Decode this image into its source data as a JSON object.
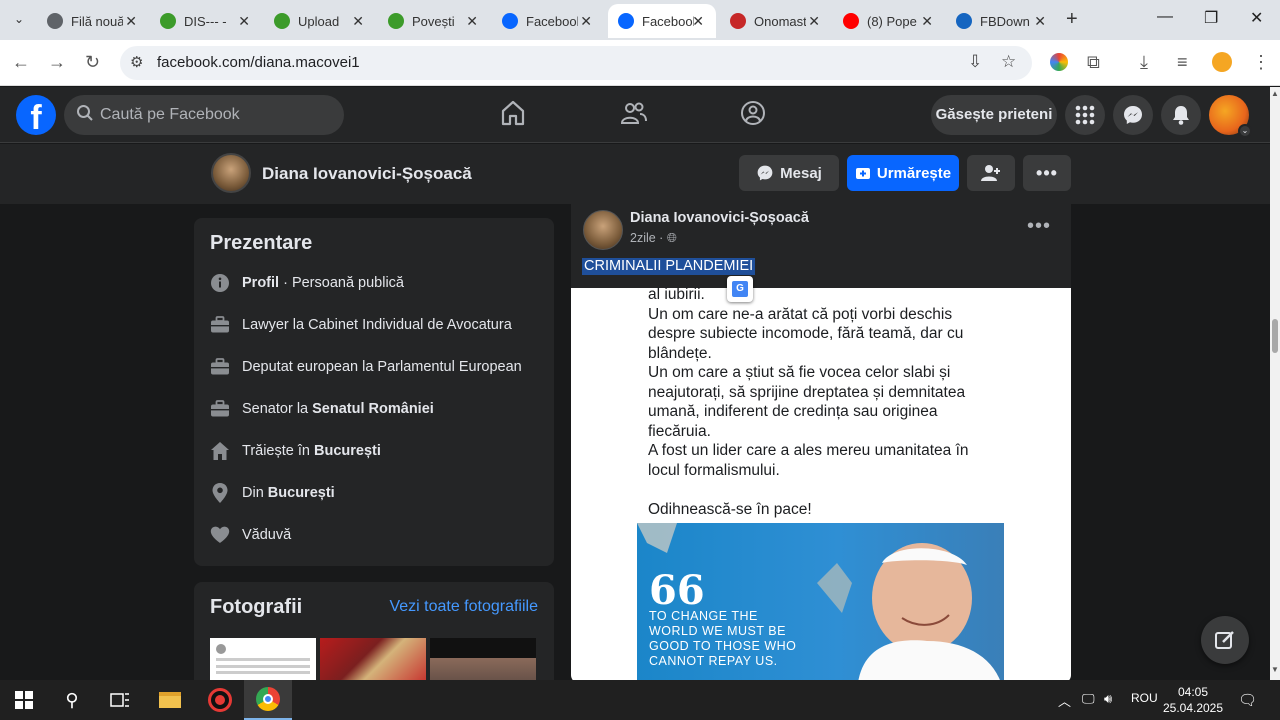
{
  "browser": {
    "tabs": [
      {
        "title": "Filă nouă",
        "favicon_color": "#5f6368",
        "active": false
      },
      {
        "title": "DIS--- -",
        "favicon_color": "#3c9b2a",
        "active": false
      },
      {
        "title": "Upload",
        "favicon_color": "#3c9b2a",
        "active": false
      },
      {
        "title": "Povești",
        "favicon_color": "#3c9b2a",
        "active": false
      },
      {
        "title": "Facebook",
        "favicon_color": "#0866ff",
        "active": false
      },
      {
        "title": "Facebook",
        "favicon_color": "#0866ff",
        "active": true
      },
      {
        "title": "Onomastica",
        "favicon_color": "#c62828",
        "active": false
      },
      {
        "title": "(8) Pope",
        "favicon_color": "#ff0000",
        "active": false
      },
      {
        "title": "FBDown",
        "favicon_color": "#1565c0",
        "active": false
      }
    ],
    "url": "facebook.com/diana.macovei1"
  },
  "facebook": {
    "search_placeholder": "Caută pe Facebook",
    "find_friends": "Găsește prieteni"
  },
  "profile": {
    "name": "Diana Iovanovici-Șoșoacă",
    "message_btn": "Mesaj",
    "follow_btn": "Urmărește"
  },
  "intro": {
    "title": "Prezentare",
    "rows": [
      {
        "icon": "info-icon",
        "text_bold": "Profil",
        "text": " · Persoană publică"
      },
      {
        "icon": "briefcase-icon",
        "text": "Lawyer la Cabinet Individual de Avocatura"
      },
      {
        "icon": "briefcase-icon",
        "text": "Deputat european la Parlamentul European"
      },
      {
        "icon": "briefcase-icon",
        "text": "Senator la ",
        "text_bold": "Senatul României"
      },
      {
        "icon": "home-icon",
        "text": "Trăiește în ",
        "text_bold": "București"
      },
      {
        "icon": "location-pin-icon",
        "text": "Din ",
        "text_bold": "București"
      },
      {
        "icon": "heart-icon",
        "text": "Văduvă"
      }
    ]
  },
  "photos": {
    "title": "Fotografii",
    "see_all": "Vezi toate fotografiile"
  },
  "post": {
    "author": "Diana Iovanovici-Șoșoacă",
    "time": "2zile ·",
    "selected_text": "CRIMINALII PLANDEMIEI",
    "body": "al iubirii.\nUn om care ne-a arătat că poți vorbi deschis despre subiecte incomode, fără teamă, dar cu blândețe.\nUn om care a știut să fie vocea celor slabi și neajutorați, să sprijine dreptatea și demnitatea umană, indiferent de credința sau originea fiecăruia.\nA fost un lider care a ales mereu umanitatea în locul formalismului.\n\nOdihnească-se în pace!",
    "image_quote_mark": "66",
    "image_quote": "TO CHANGE THE WORLD WE MUST BE GOOD TO THOSE WHO CANNOT REPAY US."
  },
  "taskbar": {
    "lang": "ROU",
    "time": "04:05",
    "date": "25.04.2025"
  }
}
